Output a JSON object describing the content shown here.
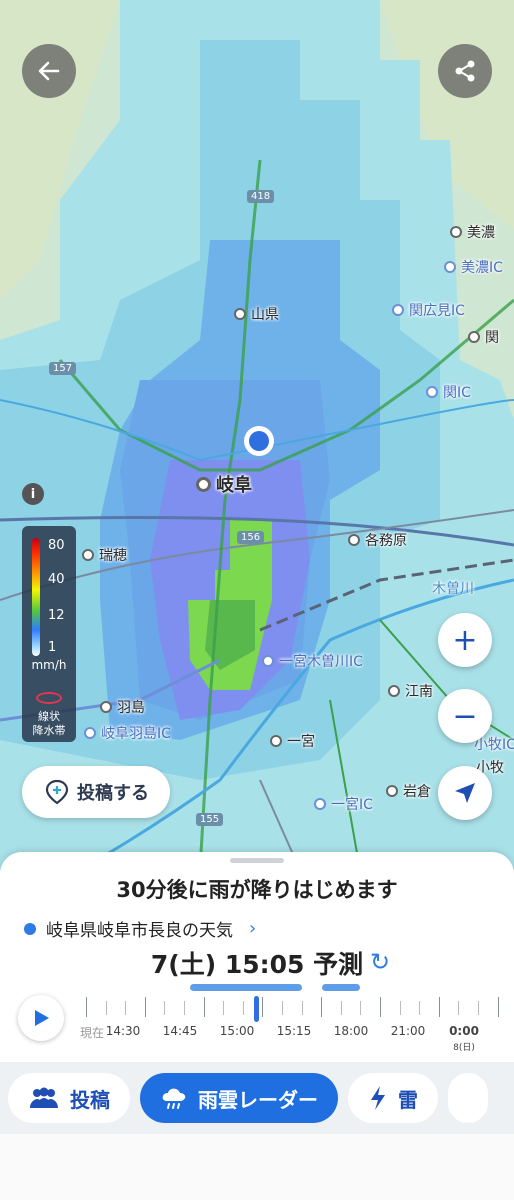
{
  "header": {
    "back_icon": "arrow-left-icon",
    "share_icon": "share-icon"
  },
  "map": {
    "places": [
      {
        "name": "美濃"
      },
      {
        "name": "美濃IC"
      },
      {
        "name": "関広見IC"
      },
      {
        "name": "関"
      },
      {
        "name": "関IC"
      },
      {
        "name": "山県"
      },
      {
        "name": "岐阜"
      },
      {
        "name": "瑞穂"
      },
      {
        "name": "各務原"
      },
      {
        "name": "木曽川"
      },
      {
        "name": "羽島"
      },
      {
        "name": "岐阜羽島IC"
      },
      {
        "name": "一宮木曽川IC"
      },
      {
        "name": "江南"
      },
      {
        "name": "一宮"
      },
      {
        "name": "岩倉"
      },
      {
        "name": "一宮IC"
      },
      {
        "name": "小牧IC"
      },
      {
        "name": "小牧"
      }
    ],
    "road_shields": [
      "418",
      "157",
      "156",
      "155"
    ]
  },
  "legend": {
    "info_label": "i",
    "ticks": [
      "80",
      "40",
      "12",
      "1"
    ],
    "unit": "mm/h",
    "band_label_1": "線状",
    "band_label_2": "降水帯"
  },
  "post_button": {
    "label": "投稿する",
    "icon": "post-pin-icon"
  },
  "controls": {
    "zoom_in": "+",
    "zoom_out": "−",
    "locate_icon": "navigation-arrow-icon"
  },
  "sheet": {
    "headline": "30分後に雨が降りはじめます",
    "location": "岐阜県岐阜市長良の天気",
    "time_display": "7(土) 15:05 予測",
    "refresh_icon": "refresh-icon",
    "timeline": {
      "labels": [
        "現在",
        "14:30",
        "14:45",
        "15:00",
        "15:15",
        "18:00",
        "21:00",
        "0:00"
      ],
      "sublabel": "8(日)"
    }
  },
  "tabs": [
    {
      "label": "投稿",
      "icon": "people-icon"
    },
    {
      "label": "雨雲レーダー",
      "icon": "rain-cloud-icon",
      "active": true
    },
    {
      "label": "雷",
      "icon": "lightning-icon"
    }
  ],
  "colors": {
    "accent": "#1f6fe0",
    "rain_light": "#9ed9f0",
    "rain_mid": "#6ea8e8",
    "rain_heavy": "#7f8ff0",
    "rain_green": "#7cd84f"
  }
}
